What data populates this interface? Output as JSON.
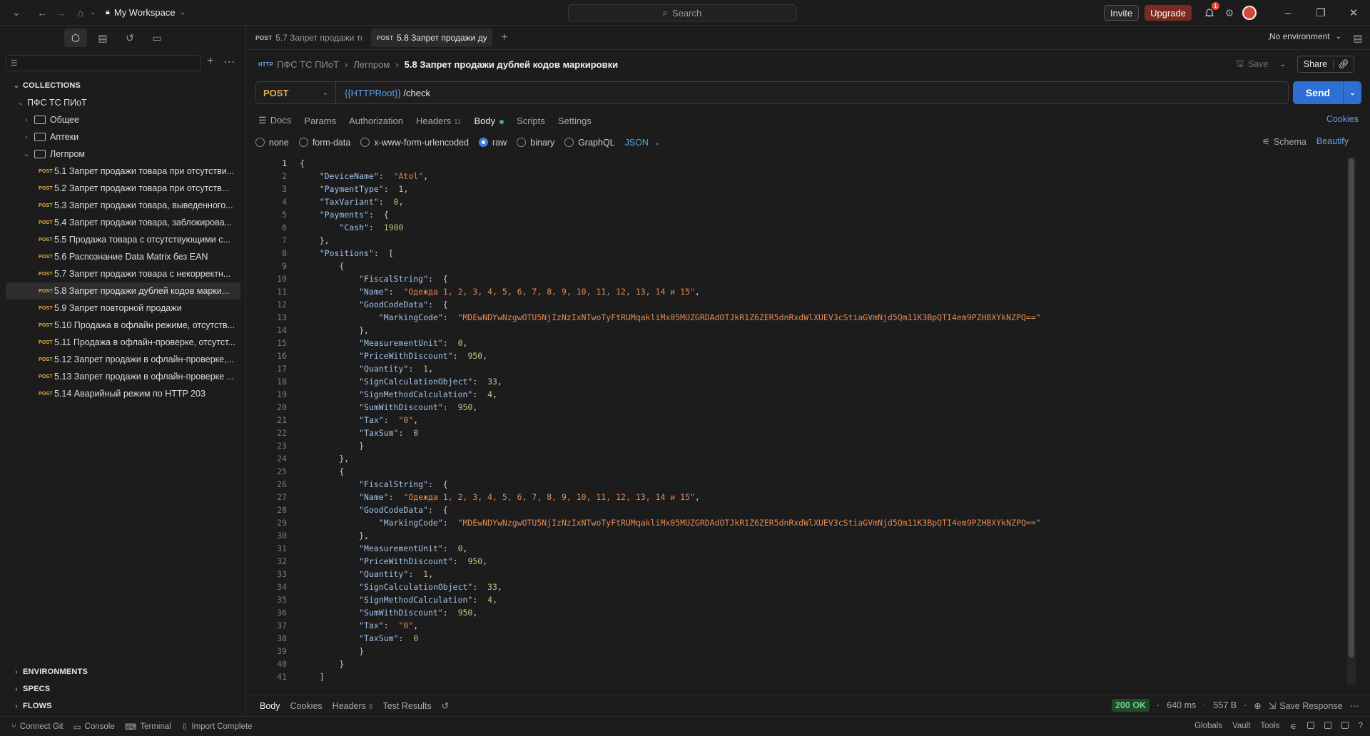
{
  "app": {
    "workspace": "My Workspace",
    "search_placeholder": "Search",
    "invite": "Invite",
    "upgrade": "Upgrade",
    "notification_count": "1"
  },
  "sidebar": {
    "collections_label": "COLLECTIONS",
    "collection_name": "ПФС ТС ПИоТ",
    "folders": [
      "Общее",
      "Аптеки",
      "Легпром"
    ],
    "method": "POST",
    "requests": [
      "5.1 Запрет продажи товара при отсутстви...",
      "5.2 Запрет продажи товара при отсутств...",
      "5.3 Запрет продажи товара, выведенного...",
      "5.4 Запрет продажи товара, заблокирова...",
      "5.5 Продажа товара с отсутствующими с...",
      "5.6 Распознание Data Matrix без EAN",
      "5.7 Запрет продажи товара с некорректн...",
      "5.8 Запрет продажи дублей кодов марки...",
      "5.9 Запрет повторной продажи",
      "5.10 Продажа в офлайн режиме, отсутств...",
      "5.11 Продажа в офлайн-проверке, отсутст...",
      "5.12 Запрет продажи в офлайн-проверке,...",
      "5.13 Запрет продажи в офлайн-проверке ...",
      "5.14 Аварийный режим по HTTP 203"
    ],
    "environments": "ENVIRONMENTS",
    "specs": "SPECS",
    "flows": "FLOWS"
  },
  "tabs": [
    {
      "method": "POST",
      "title": "5.7 Запрет продажи то"
    },
    {
      "method": "POST",
      "title": "5.8 Запрет продажи ду"
    }
  ],
  "environment": "No environment",
  "request": {
    "breadcrumb": [
      "ПФС ТС ПИоТ",
      "Легпром",
      "5.8 Запрет продажи дублей кодов маркировки"
    ],
    "save": "Save",
    "share": "Share",
    "method": "POST",
    "url_var": "{{HTTPRoot}}",
    "url_path": " /check",
    "send": "Send",
    "tabs": [
      "Docs",
      "Params",
      "Authorization",
      "Headers",
      "Body",
      "Scripts",
      "Settings"
    ],
    "headers_count": "11",
    "cookies": "Cookies",
    "body_types": [
      "none",
      "form-data",
      "x-www-form-urlencoded",
      "raw",
      "binary",
      "GraphQL"
    ],
    "body_format": "JSON",
    "schema": "Schema",
    "beautify": "Beautify"
  },
  "code_lines": [
    "{",
    "    \"DeviceName\":  \"Atol\",",
    "    \"PaymentType\":  1,",
    "    \"TaxVariant\":  0,",
    "    \"Payments\":  {",
    "        \"Cash\":  1900",
    "    },",
    "    \"Positions\":  [",
    "        {",
    "            \"FiscalString\":  {",
    "            \"Name\":  \"Одежда 1, 2, 3, 4, 5, 6, 7, 8, 9, 10, 11, 12, 13, 14 и 15\",",
    "            \"GoodCodeData\":  {",
    "                \"MarkingCode\":  \"MDEwNDYwNzgwOTU5NjIzNzIxNTwoTyFtRUMqakliMx05MUZGRDAdOTJkR1Z6ZER5dnRxdWlXUEV3cStiaGVmNjd5Qm11K3BpQTI4em9PZHBXYkNZPQ==\"",
    "            },",
    "            \"MeasurementUnit\":  0,",
    "            \"PriceWithDiscount\":  950,",
    "            \"Quantity\":  1,",
    "            \"SignCalculationObject\":  33,",
    "            \"SignMethodCalculation\":  4,",
    "            \"SumWithDiscount\":  950,",
    "            \"Tax\":  \"0\",",
    "            \"TaxSum\":  0",
    "            }",
    "        },",
    "        {",
    "            \"FiscalString\":  {",
    "            \"Name\":  \"Одежда 1, 2, 3, 4, 5, 6, 7, 8, 9, 10, 11, 12, 13, 14 и 15\",",
    "            \"GoodCodeData\":  {",
    "                \"MarkingCode\":  \"MDEwNDYwNzgwOTU5NjIzNzIxNTwoTyFtRUMqakliMx05MUZGRDAdOTJkR1Z6ZER5dnRxdWlXUEV3cStiaGVmNjd5Qm11K3BpQTI4em9PZHBXYkNZPQ==\"",
    "            },",
    "            \"MeasurementUnit\":  0,",
    "            \"PriceWithDiscount\":  950,",
    "            \"Quantity\":  1,",
    "            \"SignCalculationObject\":  33,",
    "            \"SignMethodCalculation\":  4,",
    "            \"SumWithDiscount\":  950,",
    "            \"Tax\":  \"0\",",
    "            \"TaxSum\":  0",
    "            }",
    "        }",
    "    ]",
    "}"
  ],
  "response": {
    "tabs": [
      "Body",
      "Cookies",
      "Headers",
      "Test Results"
    ],
    "headers_count": "8",
    "status": "200 OK",
    "time": "640 ms",
    "size": "557 B",
    "save_response": "Save Response"
  },
  "statusbar": {
    "left": [
      "Connect Git",
      "Console",
      "Terminal",
      "Import Complete"
    ],
    "right": [
      "Globals",
      "Vault",
      "Tools"
    ]
  }
}
